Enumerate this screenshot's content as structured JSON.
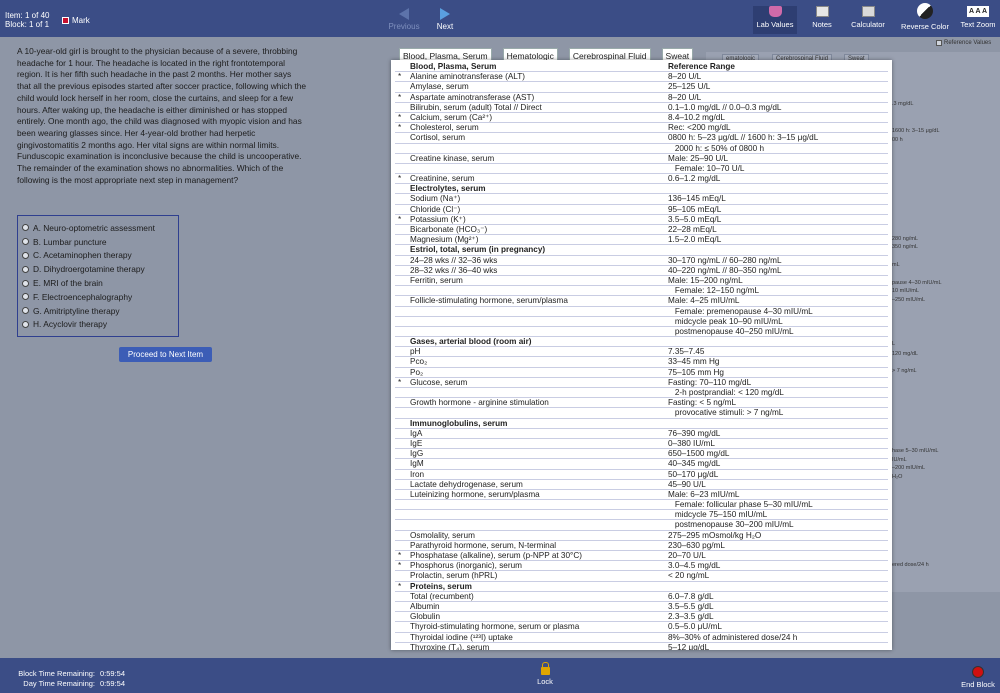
{
  "header": {
    "item_label": "Item: 1 of 40",
    "block_label": "Block: 1 of 1",
    "mark_label": "Mark",
    "previous_label": "Previous",
    "next_label": "Next",
    "tools": {
      "lab_values": "Lab Values",
      "notes": "Notes",
      "calculator": "Calculator",
      "reverse_color": "Reverse Color",
      "text_zoom": "Text Zoom",
      "text_zoom_glyph": "A A A"
    }
  },
  "question": {
    "stem": "A 10-year-old girl is brought to the physician because of a severe, throbbing headache for 1 hour. The headache is located in the right frontotemporal region. It is her fifth such headache in the past 2 months. Her mother says that all the previous episodes started after soccer practice, following which the child would lock herself in her room, close the curtains, and sleep for a few hours. After waking up, the headache is either diminished or has stopped entirely. One month ago, the child was diagnosed with myopic vision and has been wearing glasses since. Her 4-year-old brother had herpetic gingivostomatitis 2 months ago. Her vital signs are within normal limits. Funduscopic examination is inconclusive because the child is uncooperative. The remainder of the examination shows no abnormalities. Which of the following is the most appropriate next step in management?",
    "answers": [
      "A. Neuro-optometric assessment",
      "B. Lumbar puncture",
      "C. Acetaminophen therapy",
      "D. Dihydroergotamine therapy",
      "E. MRI of the brain",
      "F. Electroencephalography",
      "G. Amitriptyline therapy",
      "H. Acyclovir therapy"
    ],
    "proceed_label": "Proceed to Next Item"
  },
  "lab": {
    "tabs": [
      "Blood, Plasma, Serum",
      "Hematologic",
      "Cerebrospinal Fluid",
      "Sweat"
    ],
    "rows": [
      {
        "star": "",
        "name": "Blood, Plasma, Serum",
        "value": "Reference Range",
        "kind": "header"
      },
      {
        "star": "*",
        "name": "Alanine aminotransferase (ALT)",
        "value": "8–20 U/L"
      },
      {
        "star": "",
        "name": "Amylase, serum",
        "value": "25–125 U/L"
      },
      {
        "star": "*",
        "name": "Aspartate aminotransferase (AST)",
        "value": "8–20 U/L"
      },
      {
        "star": "",
        "name": "Bilirubin, serum (adult) Total // Direct",
        "value": "0.1–1.0 mg/dL // 0.0–0.3 mg/dL"
      },
      {
        "star": "*",
        "name": "Calcium, serum (Ca²⁺)",
        "value": "8.4–10.2 mg/dL"
      },
      {
        "star": "*",
        "name": "Cholesterol, serum",
        "value": "Rec: <200 mg/dL"
      },
      {
        "star": "",
        "name": "Cortisol, serum",
        "value": "0800 h: 5–23 μg/dL // 1600 h: 3–15 μg/dL"
      },
      {
        "star": "",
        "name": "",
        "value": "   2000 h: ≤ 50% of 0800 h"
      },
      {
        "star": "",
        "name": "Creatine kinase, serum",
        "value": "Male: 25–90 U/L"
      },
      {
        "star": "",
        "name": "",
        "value": "   Female: 10–70 U/L"
      },
      {
        "star": "*",
        "name": "Creatinine, serum",
        "value": "0.6–1.2 mg/dL"
      },
      {
        "star": "",
        "name": "Electrolytes, serum",
        "value": "",
        "kind": "section"
      },
      {
        "star": "",
        "name": "Sodium (Na⁺)",
        "value": "136–145 mEq/L"
      },
      {
        "star": "",
        "name": "Chloride (Cl⁻)",
        "value": "95–105 mEq/L"
      },
      {
        "star": "*",
        "name": "Potassium (K⁺)",
        "value": "3.5–5.0 mEq/L"
      },
      {
        "star": "",
        "name": "Bicarbonate (HCO₃⁻)",
        "value": "22–28 mEq/L"
      },
      {
        "star": "",
        "name": "Magnesium (Mg²⁺)",
        "value": "1.5–2.0 mEq/L"
      },
      {
        "star": "",
        "name": "Estriol, total, serum (in pregnancy)",
        "value": "",
        "kind": "section"
      },
      {
        "star": "",
        "name": "24–28 wks // 32–36 wks",
        "value": "30–170 ng/mL // 60–280 ng/mL"
      },
      {
        "star": "",
        "name": "28–32 wks // 36–40 wks",
        "value": "40–220 ng/mL // 80–350 ng/mL"
      },
      {
        "star": "",
        "name": "Ferritin, serum",
        "value": "Male: 15–200 ng/mL"
      },
      {
        "star": "",
        "name": "",
        "value": "   Female: 12–150 ng/mL"
      },
      {
        "star": "",
        "name": "Follicle-stimulating hormone, serum/plasma",
        "value": "Male: 4–25 mIU/mL"
      },
      {
        "star": "",
        "name": "",
        "value": "   Female: premenopause 4–30 mIU/mL"
      },
      {
        "star": "",
        "name": "",
        "value": "   midcycle peak 10–90 mIU/mL"
      },
      {
        "star": "",
        "name": "",
        "value": "   postmenopause 40–250 mIU/mL"
      },
      {
        "star": "",
        "name": "Gases, arterial blood (room air)",
        "value": "",
        "kind": "section"
      },
      {
        "star": "",
        "name": "pH",
        "value": "7.35–7.45"
      },
      {
        "star": "",
        "name": "Pco₂",
        "value": "33–45 mm Hg"
      },
      {
        "star": "",
        "name": "Po₂",
        "value": "75–105 mm Hg"
      },
      {
        "star": "*",
        "name": "Glucose, serum",
        "value": "Fasting: 70–110 mg/dL"
      },
      {
        "star": "",
        "name": "",
        "value": "   2-h postprandial: < 120 mg/dL"
      },
      {
        "star": "",
        "name": "Growth hormone - arginine stimulation",
        "value": "Fasting: < 5 ng/mL"
      },
      {
        "star": "",
        "name": "",
        "value": "   provocative stimuli: > 7 ng/mL"
      },
      {
        "star": "",
        "name": "Immunoglobulins, serum",
        "value": "",
        "kind": "section"
      },
      {
        "star": "",
        "name": "IgA",
        "value": "76–390 mg/dL"
      },
      {
        "star": "",
        "name": "IgE",
        "value": "0–380 IU/mL"
      },
      {
        "star": "",
        "name": "IgG",
        "value": "650–1500 mg/dL"
      },
      {
        "star": "",
        "name": "IgM",
        "value": "40–345 mg/dL"
      },
      {
        "star": "",
        "name": "Iron",
        "value": "50–170 μg/dL"
      },
      {
        "star": "",
        "name": "Lactate dehydrogenase, serum",
        "value": "45–90 U/L"
      },
      {
        "star": "",
        "name": "Luteinizing hormone, serum/plasma",
        "value": "Male: 6–23 mIU/mL"
      },
      {
        "star": "",
        "name": "",
        "value": "   Female: follicular phase 5–30 mIU/mL"
      },
      {
        "star": "",
        "name": "",
        "value": "   midcycle 75–150 mIU/mL"
      },
      {
        "star": "",
        "name": "",
        "value": "   postmenopause 30–200 mIU/mL"
      },
      {
        "star": "",
        "name": "Osmolality, serum",
        "value": "275–295 mOsmol/kg H₂O"
      },
      {
        "star": "",
        "name": "Parathyroid hormone, serum, N-terminal",
        "value": "230–630 pg/mL"
      },
      {
        "star": "*",
        "name": "Phosphatase (alkaline), serum (p-NPP at 30°C)",
        "value": "20–70 U/L"
      },
      {
        "star": "*",
        "name": "Phosphorus (inorganic), serum",
        "value": "3.0–4.5 mg/dL"
      },
      {
        "star": "",
        "name": "Prolactin, serum (hPRL)",
        "value": "< 20 ng/mL"
      },
      {
        "star": "*",
        "name": "Proteins, serum",
        "value": "",
        "kind": "section"
      },
      {
        "star": "",
        "name": "Total (recumbent)",
        "value": "6.0–7.8 g/dL"
      },
      {
        "star": "",
        "name": "Albumin",
        "value": "3.5–5.5 g/dL"
      },
      {
        "star": "",
        "name": "Globulin",
        "value": "2.3–3.5 g/dL"
      },
      {
        "star": "",
        "name": "Thyroid-stimulating hormone, serum or plasma",
        "value": "0.5–5.0 μU/mL"
      },
      {
        "star": "",
        "name": "Thyroidal iodine (¹²³I) uptake",
        "value": "8%–30% of administered dose/24 h"
      },
      {
        "star": "",
        "name": "Thyroxine (T₄), serum",
        "value": "5–12 μg/dL"
      }
    ]
  },
  "background_lab": {
    "tabs": [
      "ematologic",
      "Cerebrospinal Fluid",
      "Sweat"
    ],
    "ref_toggle_label": "Reference Values",
    "fragments": [
      ".3 mg/dL",
      "1600 h: 3–15 μg/dL",
      "00 h",
      "280 ng/mL",
      "350 ng/mL",
      "mL",
      "pause 4–30 mIU/mL",
      "10 mIU/mL",
      "–250 mIU/mL",
      "L",
      "120 mg/dL",
      "> 7 ng/mL",
      "hase 5–30 mIU/mL",
      "IU/mL",
      "–200 mIU/mL",
      "H₂O",
      "ered dose/24 h"
    ]
  },
  "footer": {
    "block_time_label": "Block Time Remaining:",
    "block_time_value": "0:59:54",
    "day_time_label": "Day Time Remaining:",
    "day_time_value": "0:59:54",
    "lock_label": "Lock",
    "end_block_label": "End Block"
  }
}
